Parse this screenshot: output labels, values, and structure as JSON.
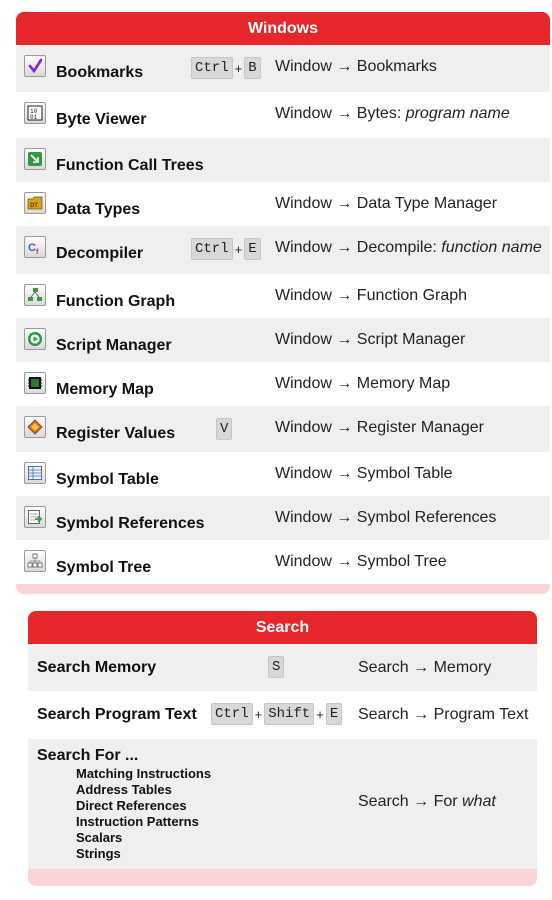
{
  "windows": {
    "title": "Windows",
    "rows": [
      {
        "name": "Bookmarks",
        "keys": [
          "Ctrl",
          "B"
        ],
        "menu": "Window → Bookmarks",
        "menu_italic": "",
        "icon": "bookmark-check-icon",
        "icon_color": "#8b1fd6"
      },
      {
        "name": "Byte Viewer",
        "keys": [],
        "menu": "Window → Bytes: ",
        "menu_italic": "program name",
        "icon": "byte-viewer-icon",
        "icon_color": "#222222"
      },
      {
        "name": "Function Call Trees",
        "keys": [],
        "menu": "",
        "menu_italic": "",
        "icon": "call-tree-icon",
        "icon_color": "#2e9a3a"
      },
      {
        "name": "Data Types",
        "keys": [],
        "menu": "Window → Data Type Manager",
        "menu_italic": "",
        "icon": "data-types-folder-icon",
        "icon_color": "#d9a21b"
      },
      {
        "name": "Decompiler",
        "keys": [
          "Ctrl",
          "E"
        ],
        "menu": "Window → Decompile: ",
        "menu_italic": "function name",
        "icon": "decompiler-icon",
        "icon_color": "#3b5fd6"
      },
      {
        "name": "Function Graph",
        "keys": [],
        "menu": "Window → Function Graph",
        "menu_italic": "",
        "icon": "function-graph-icon",
        "icon_color": "#3a9a3a"
      },
      {
        "name": "Script Manager",
        "keys": [],
        "menu": "Window → Script Manager",
        "menu_italic": "",
        "icon": "play-script-icon",
        "icon_color": "#1e9e3a"
      },
      {
        "name": "Memory Map",
        "keys": [],
        "menu": "Window → Memory Map",
        "menu_italic": "",
        "icon": "memory-chip-icon",
        "icon_color": "#2a7a2a"
      },
      {
        "name": "Register Values",
        "keys": [
          "V"
        ],
        "menu": "Window → Register Manager",
        "menu_italic": "",
        "icon": "register-diamond-icon",
        "icon_color": "#e06a1a"
      },
      {
        "name": "Symbol Table",
        "keys": [],
        "menu": "Window → Symbol Table",
        "menu_italic": "",
        "icon": "symbol-table-icon",
        "icon_color": "#4a6fb5"
      },
      {
        "name": "Symbol References",
        "keys": [],
        "menu": "Window → Symbol References",
        "menu_italic": "",
        "icon": "symbol-references-icon",
        "icon_color": "#3a9a3a"
      },
      {
        "name": "Symbol Tree",
        "keys": [],
        "menu": "Window → Symbol Tree",
        "menu_italic": "",
        "icon": "symbol-tree-icon",
        "icon_color": "#7a7a7a"
      }
    ]
  },
  "search": {
    "title": "Search",
    "rows": [
      {
        "name": "Search Memory",
        "keys": [
          "S"
        ],
        "menu": "Search → Memory",
        "menu_italic": "",
        "subs": []
      },
      {
        "name": "Search Program Text",
        "keys": [
          "Ctrl",
          "Shift",
          "E"
        ],
        "menu": "Search → Program Text",
        "menu_italic": "",
        "subs": []
      },
      {
        "name": "Search For ...",
        "keys": [],
        "menu": "Search → For ",
        "menu_italic": "what",
        "subs": [
          "Matching Instructions",
          "Address Tables",
          "Direct References",
          "Instruction Patterns",
          "Scalars",
          "Strings"
        ]
      }
    ]
  },
  "colors": {
    "header": "#e5262a",
    "panel_tint": "#fbd4d4",
    "row_alt": "#efefef",
    "key_bg": "#d8d8d8"
  }
}
